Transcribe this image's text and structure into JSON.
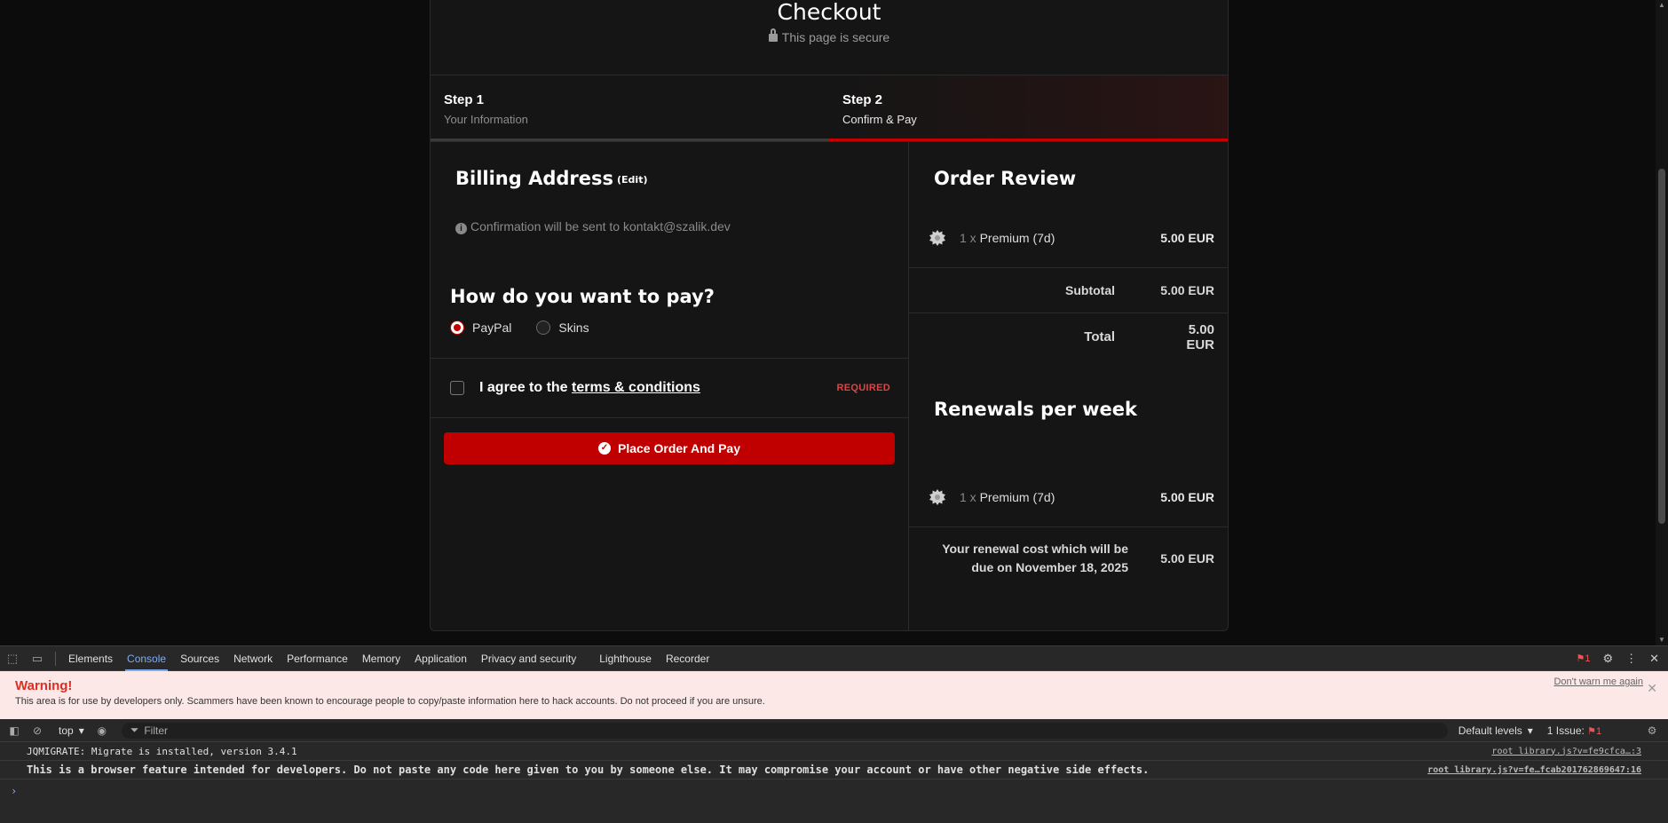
{
  "checkout": {
    "title": "Checkout",
    "secure_text": "This page is secure",
    "steps": [
      {
        "title": "Step 1",
        "subtitle": "Your Information"
      },
      {
        "title": "Step 2",
        "subtitle": "Confirm & Pay"
      }
    ],
    "billing": {
      "heading": "Billing Address",
      "edit_label": "(Edit)",
      "confirmation": "Confirmation will be sent to kontakt@szalik.dev"
    },
    "payment": {
      "heading": "How do you want to pay?",
      "methods": [
        {
          "label": "PayPal",
          "selected": true
        },
        {
          "label": "Skins",
          "selected": false
        }
      ]
    },
    "agree": {
      "prefix": "I agree to the",
      "link": "terms & conditions",
      "required": "REQUIRED"
    },
    "place_order": "Place Order And Pay",
    "order_review": {
      "heading": "Order Review",
      "item": {
        "qty": "1 x",
        "name": "Premium (7d)",
        "price": "5.00 EUR"
      },
      "subtotal_label": "Subtotal",
      "subtotal_value": "5.00 EUR",
      "total_label": "Total",
      "total_value": "5.00 EUR"
    },
    "renewals": {
      "heading": "Renewals per week",
      "item": {
        "qty": "1 x",
        "name": "Premium (7d)",
        "price": "5.00 EUR"
      },
      "note": "Your renewal cost which will be due on November 18, 2025",
      "note_value": "5.00 EUR"
    }
  },
  "devtools": {
    "tabs": [
      "Elements",
      "Console",
      "Sources",
      "Network",
      "Performance",
      "Memory",
      "Application",
      "Privacy and security",
      "Lighthouse",
      "Recorder"
    ],
    "active_tab": "Console",
    "issue_count": "1",
    "warning": {
      "title": "Warning!",
      "text": "This area is for use by developers only. Scammers have been known to encourage people to copy/paste information here to hack accounts. Do not proceed if you are unsure.",
      "dismiss": "Don't warn me again"
    },
    "console_bar": {
      "context": "top",
      "filter_placeholder": "Filter",
      "levels": "Default levels",
      "issues": "1 Issue:",
      "issues_count": "1"
    },
    "lines": [
      {
        "text": "JQMIGRATE: Migrate is installed, version 3.4.1",
        "source": "root library.js?v=fe9cfca…:3"
      },
      {
        "text": "This is a browser feature intended for developers. Do not paste any code here given to you by someone else. It may compromise your account or have other negative side effects.",
        "source": "root library.js?v=fe…fcab201762869647:16"
      }
    ],
    "prompt": "›"
  },
  "colors": {
    "accent": "#c00000",
    "background": "#0c0c0c",
    "card": "#151515",
    "devtools_link": "#7cacf8"
  }
}
